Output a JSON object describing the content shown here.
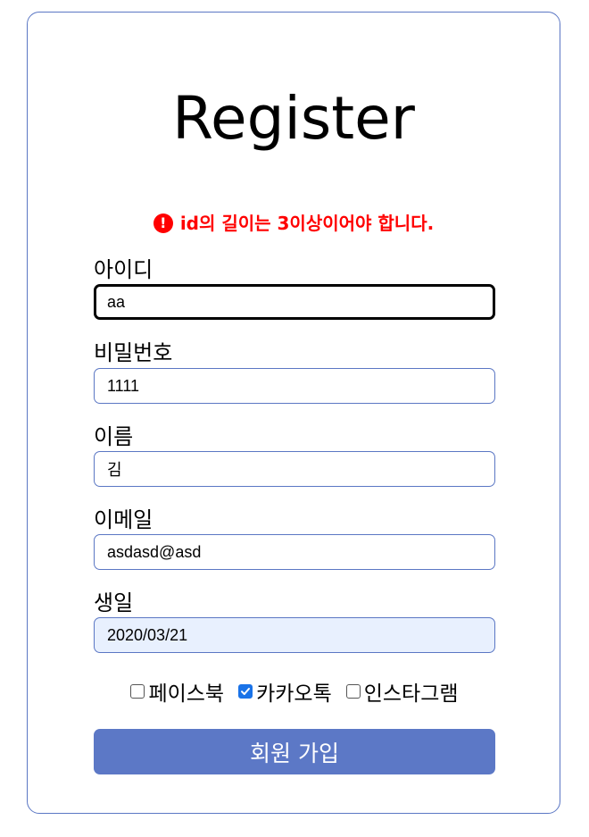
{
  "form": {
    "title": "Register",
    "error": {
      "icon": "exclamation-circle-icon",
      "message": "id의 길이는 3이상이어야 합니다.",
      "color": "#ff0000"
    },
    "fields": [
      {
        "label": "아이디",
        "value": "aa",
        "state": "focused"
      },
      {
        "label": "비밀번호",
        "value": "1111",
        "state": "normal"
      },
      {
        "label": "이름",
        "value": "김",
        "state": "normal"
      },
      {
        "label": "이메일",
        "value": "asdasd@asd",
        "state": "normal"
      },
      {
        "label": "생일",
        "value": "2020/03/21",
        "state": "autofill"
      }
    ],
    "checkboxes": [
      {
        "label": "페이스북",
        "checked": false
      },
      {
        "label": "카카오톡",
        "checked": true
      },
      {
        "label": "인스타그램",
        "checked": false
      }
    ],
    "submit_label": "회원 가입",
    "accent_color": "#5c78c6"
  }
}
